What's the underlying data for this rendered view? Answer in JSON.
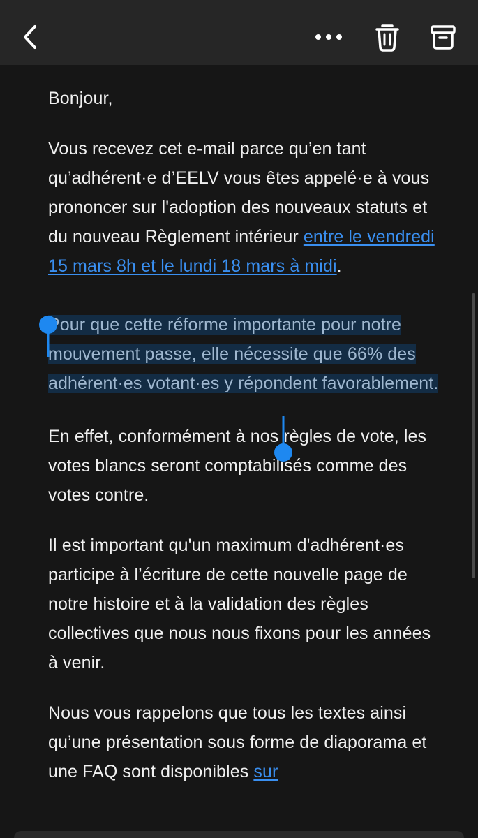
{
  "toolbar": {
    "back_icon": "chevron-left-icon",
    "more_icon": "ellipsis-icon",
    "trash_icon": "trash-icon",
    "archive_icon": "archive-box-icon"
  },
  "email": {
    "greeting": "Bonjour,",
    "p1_text": "Vous recevez cet e-mail parce qu’en tant qu’adhérent·e d’EELV vous êtes appelé·e à vous prononcer sur l'adoption des nouveaux statuts et du nouveau Règlement intérieur ",
    "p1_link": "entre le vendredi 15 mars 8h et le lundi 18 mars à midi",
    "p1_end": ".",
    "p2_selected": "Pour que cette réforme importante pour notre mouvement passe, elle nécessite que 66% des adhérent·es votant·es y répondent favorablement.",
    "p3": "En effet, conformément à nos règles de vote, les votes blancs seront comptabilisés comme des votes contre.",
    "p4": "Il est important qu'un maximum d'adhérent·es participe à l’écriture de cette nouvelle page de notre histoire et à la validation des règles collectives que nous nous fixons pour les années à venir.",
    "p5_text": "Nous vous rappelons que tous les textes ainsi qu’une présentation sous forme de diaporama et une FAQ sont disponibles ",
    "p5_link": "sur"
  },
  "colors": {
    "background": "#161616",
    "toolbar": "#262626",
    "text": "#f0f0f0",
    "link": "#3a8ff0",
    "selection_bg": "#132c44",
    "handle": "#1e88f0"
  }
}
